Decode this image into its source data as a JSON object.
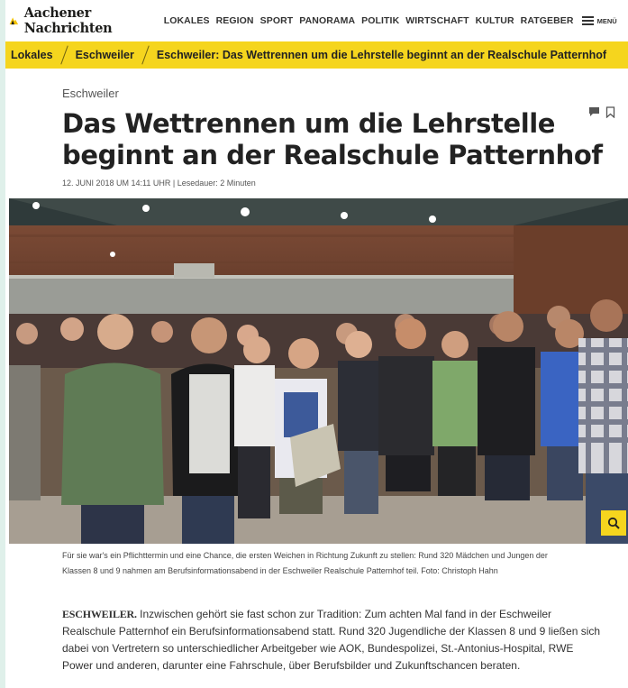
{
  "site": {
    "name": "Aachener Nachrichten",
    "logo_icon": "regional-map-icon"
  },
  "nav": {
    "items": [
      "LOKALES",
      "REGION",
      "SPORT",
      "PANORAMA",
      "POLITIK",
      "WIRTSCHAFT",
      "KULTUR",
      "RATGEBER"
    ],
    "menu_label": "MENÜ"
  },
  "breadcrumb": {
    "items": [
      "Lokales",
      "Eschweiler",
      "Eschweiler: Das Wettrennen um die Lehrstelle beginnt an der Realschule Patternhof"
    ]
  },
  "article": {
    "category": "Eschweiler",
    "title": "Das Wettrennen um die Lehrstelle beginnt an der Realschule Patternhof",
    "meta": "12. JUNI 2018 UM 14:11 UHR | Lesedauer: 2 Minuten",
    "caption": "Für sie war's ein Pflichttermin und eine Chance, die ersten Weichen in Richtung Zukunft zu stellen: Rund 320 Mädchen und Jungen der Klassen 8 und 9 nahmen am Berufsinformationsabend in der Eschweiler Realschule Patternhof teil. Foto: Christoph Hahn",
    "dateline": "ESCHWEILER.",
    "body": "Inzwischen gehört sie fast schon zur Tradition: Zum achten Mal fand in der Eschweiler Realschule Patternhof ein Berufsinformationsabend statt. Rund 320 Jugendliche der Klassen 8 und 9 ließen sich dabei von Vertretern so unterschiedlicher Arbeitgeber wie AOK, Bundespolizei, St.-Antonius-Hospital, RWE Power und anderen, darunter eine Fahrschule, über Berufsbilder und Zukunftschancen beraten."
  },
  "colors": {
    "accent": "#f5d51e",
    "text": "#222222",
    "strip": "#dff0ea"
  }
}
